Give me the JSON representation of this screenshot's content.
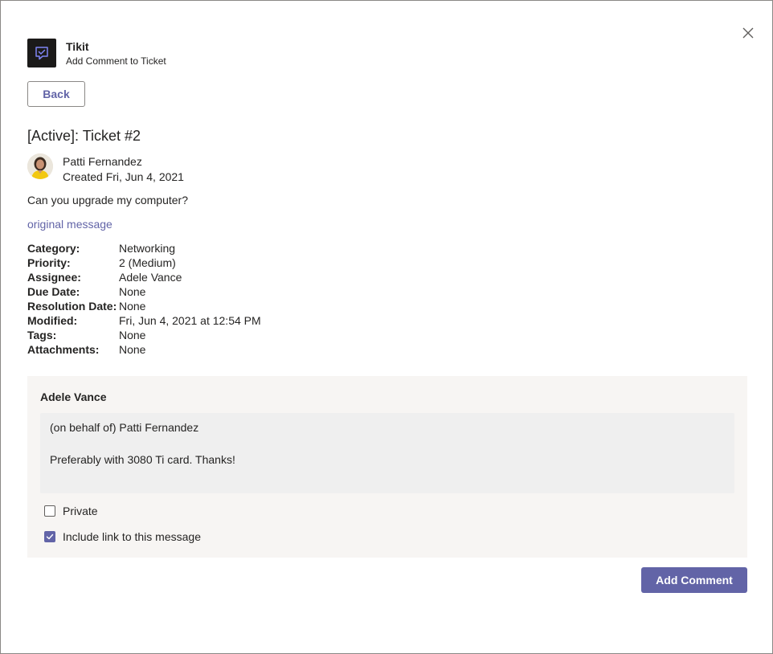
{
  "header": {
    "app_name": "Tikit",
    "subtitle": "Add Comment to Ticket",
    "logo_icon": "chat-check-icon"
  },
  "back_label": "Back",
  "ticket": {
    "title": "[Active]: Ticket #2",
    "author": "Patti Fernandez",
    "created": "Created Fri, Jun 4, 2021",
    "message": "Can you upgrade my computer?",
    "original_link": "original message"
  },
  "details": [
    {
      "label": "Category:",
      "value": "Networking"
    },
    {
      "label": "Priority:",
      "value": "2 (Medium)"
    },
    {
      "label": "Assignee:",
      "value": "Adele Vance"
    },
    {
      "label": "Due Date:",
      "value": "None"
    },
    {
      "label": "Resolution Date:",
      "value": "None"
    },
    {
      "label": "Modified:",
      "value": "Fri, Jun 4, 2021 at 12:54 PM"
    },
    {
      "label": "Tags:",
      "value": "None"
    },
    {
      "label": "Attachments:",
      "value": "None"
    }
  ],
  "comment": {
    "commenter": "Adele Vance",
    "text": "(on behalf of) Patti Fernandez\n\nPreferably with 3080 Ti card. Thanks!",
    "private_label": "Private",
    "private_checked": false,
    "include_link_label": "Include link to this message",
    "include_link_checked": true
  },
  "add_comment_label": "Add Comment",
  "colors": {
    "accent": "#6264a7",
    "panel_bg": "#f7f5f3",
    "input_bg": "#efefef"
  }
}
